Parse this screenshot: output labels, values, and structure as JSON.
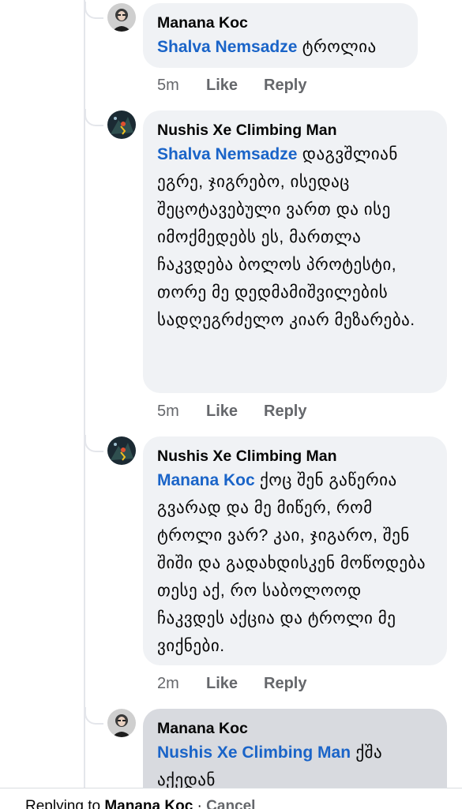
{
  "comments": [
    {
      "author": "Manana Koc",
      "mention": "Shalva Nemsadze",
      "text": " ტროლია",
      "time": "5m",
      "like": "Like",
      "reply": "Reply"
    },
    {
      "author": "Nushis Xe Climbing Man",
      "mention": "Shalva Nemsadze",
      "text": " დაგვშლიან ეგრე, ჯიგრებო, ისედაც შეცოტავებული ვართ და ისე იმოქმედებს ეს, მართლა ჩაკვდება ბოლოს პროტესტი, თორე მე დედმამიშვილების სადღეგრძელო კიარ მეზარება.",
      "time": "5m",
      "like": "Like",
      "reply": "Reply"
    },
    {
      "author": "Nushis Xe Climbing Man",
      "mention": "Manana Koc",
      "text": " ქოც შენ გაწერია გვარად და მე მიწერ, რომ ტროლი ვარ? კაი, ჯიგარო, შენ შიში და გადახდისკენ მოწოდება თესე აქ, რო საბოლოოდ ჩაკვდეს აქცია და ტროლი მე ვიქნები.",
      "time": "2m",
      "like": "Like",
      "reply": "Reply"
    },
    {
      "author": "Manana Koc",
      "mention": "Nushis Xe Climbing Man",
      "text": " ქშა აქედან"
    }
  ],
  "reply_bar": {
    "prefix": "Replying to ",
    "name": "Manana Koc",
    "separator": " · ",
    "cancel": "Cancel"
  }
}
